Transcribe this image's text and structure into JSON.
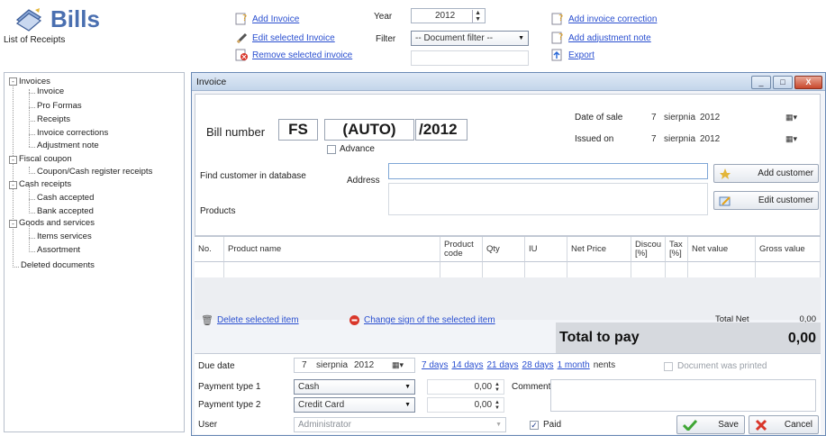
{
  "header": {
    "title": "Bills",
    "subtitle": "List of Receipts",
    "actions": {
      "add_invoice": "Add Invoice",
      "edit_invoice": "Edit selected Invoice",
      "remove_invoice": "Remove selected invoice",
      "add_correction": "Add invoice correction",
      "add_adjustment": "Add adjustment note",
      "export": "Export"
    },
    "year_label": "Year",
    "year_value": "2012",
    "filter_label": "Filter",
    "filter_value": "-- Document filter --"
  },
  "tree": [
    {
      "label": "Invoices",
      "level": 0,
      "toggle": "-"
    },
    {
      "label": "Invoice",
      "level": 1
    },
    {
      "label": "Pro Formas",
      "level": 1
    },
    {
      "label": "Receipts",
      "level": 1
    },
    {
      "label": "Invoice corrections",
      "level": 1
    },
    {
      "label": "Adjustment note",
      "level": 1
    },
    {
      "label": "Fiscal coupon",
      "level": 0,
      "toggle": "-"
    },
    {
      "label": "Coupon/Cash register receipts",
      "level": 1
    },
    {
      "label": "Cash receipts",
      "level": 0,
      "toggle": "-"
    },
    {
      "label": "Cash accepted",
      "level": 1
    },
    {
      "label": "Bank accepted",
      "level": 1
    },
    {
      "label": "Goods and services",
      "level": 0,
      "toggle": "-"
    },
    {
      "label": "Items services",
      "level": 1
    },
    {
      "label": "Assortment",
      "level": 1
    },
    {
      "label": "Deleted documents",
      "level": 0
    }
  ],
  "window": {
    "title": "Invoice",
    "controls": {
      "minimize": "_",
      "maximize": "□",
      "close": "X"
    }
  },
  "invoice": {
    "bill_number_label": "Bill number",
    "prefix": "FS",
    "number": "(AUTO)",
    "suffix": "/2012",
    "advance_label": "Advance",
    "date_of_sale_label": "Date of sale",
    "date_of_sale": {
      "day": "7",
      "month": "sierpnia",
      "year": "2012"
    },
    "issued_on_label": "Issued on",
    "issued_on": {
      "day": "7",
      "month": "sierpnia",
      "year": "2012"
    },
    "find_customer_label": "Find customer in database",
    "address_label": "Address",
    "address_value": "",
    "products_label": "Products",
    "add_customer": "Add customer",
    "edit_customer": "Edit customer"
  },
  "grid": {
    "columns": [
      "No.",
      "Product name",
      "Product code",
      "Qty",
      "IU",
      "Net Price",
      "Discou [%]",
      "Tax [%]",
      "Net value",
      "Gross value"
    ]
  },
  "grid_actions": {
    "delete": "Delete selected item",
    "change_sign": "Change sign of the selected item"
  },
  "totals": {
    "net_label": "Total Net",
    "net_value": "0,00",
    "pay_label": "Total to pay",
    "pay_value": "0,00"
  },
  "bottom": {
    "due_date_label": "Due date",
    "due_date": {
      "day": "7",
      "month": "sierpnia",
      "year": "2012"
    },
    "due_links": [
      "7 days",
      "14 days",
      "21 days",
      "28 days",
      "1 month"
    ],
    "due_links_suffix": "nents",
    "document_printed": "Document was printed",
    "payment1_label": "Payment type 1",
    "payment1_value": "Cash",
    "payment1_amount": "0,00",
    "payment2_label": "Payment type 2",
    "payment2_value": "Credit Card",
    "payment2_amount": "0,00",
    "comment_label": "Comment",
    "user_label": "User",
    "user_value": "Administrator",
    "paid_label": "Paid",
    "save": "Save",
    "cancel": "Cancel"
  }
}
